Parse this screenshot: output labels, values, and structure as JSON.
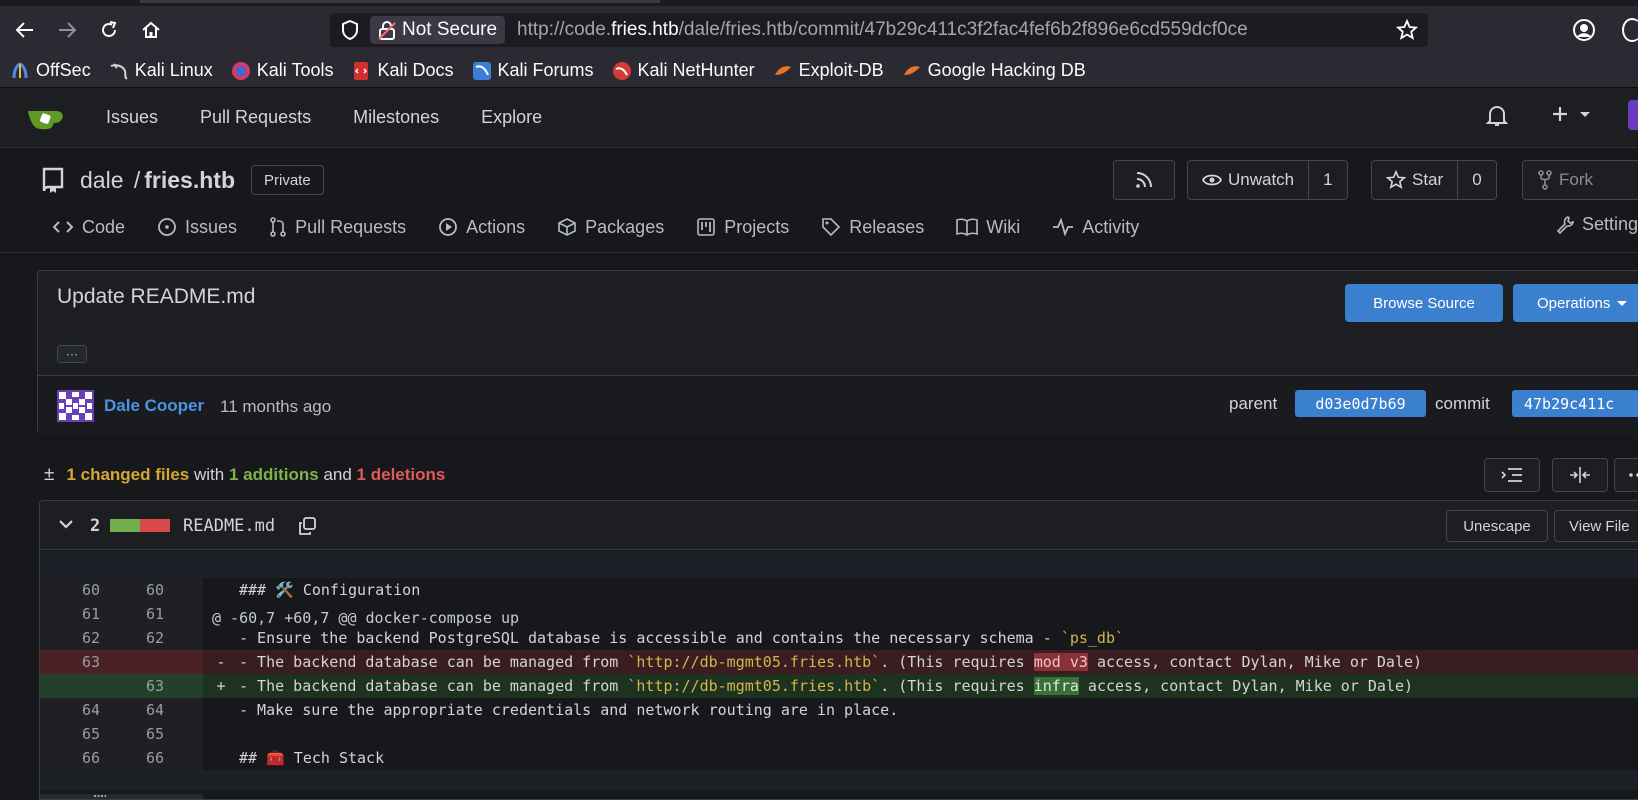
{
  "browser": {
    "url_prefix": "http://code.",
    "url_host": "fries.htb",
    "url_path": "/dale/fries.htb/commit/47b29c411c3f2fac4fef6b2f896e6cd559dcf0ce",
    "not_secure_label": "Not Secure",
    "bookmarks": [
      "OffSec",
      "Kali Linux",
      "Kali Tools",
      "Kali Docs",
      "Kali Forums",
      "Kali NetHunter",
      "Exploit-DB",
      "Google Hacking DB"
    ]
  },
  "gitea_nav": {
    "items": [
      "Issues",
      "Pull Requests",
      "Milestones",
      "Explore"
    ]
  },
  "repo": {
    "owner": "dale",
    "separator": "/",
    "name": "fries.htb",
    "visibility": "Private",
    "unwatch_label": "Unwatch",
    "watch_count": "1",
    "star_label": "Star",
    "star_count": "0",
    "fork_label": "Fork",
    "tabs": [
      "Code",
      "Issues",
      "Pull Requests",
      "Actions",
      "Packages",
      "Projects",
      "Releases",
      "Wiki",
      "Activity"
    ],
    "settings_label": "Settings"
  },
  "commit": {
    "title": "Update README.md",
    "ellipsis": "···",
    "browse_source": "Browse Source",
    "operations": "Operations",
    "author": "Dale Cooper",
    "time": "11 months ago",
    "parent_label": "parent",
    "parent_sha": "d03e0d7b69",
    "commit_label": "commit",
    "commit_sha": "47b29c411c"
  },
  "stats": {
    "pm": "±",
    "files": "1 changed files",
    "with": "with",
    "additions": "1 additions",
    "and": "and",
    "deletions": "1 deletions"
  },
  "diff_file": {
    "changes": "2",
    "filename": "README.md",
    "unescape": "Unescape",
    "view_file": "View File",
    "hunk_header": "@ -60,7 +60,7 @@ docker-compose up",
    "lines": [
      {
        "type": "ctx",
        "old": "60",
        "new": "60",
        "text": "### 🛠️ Configuration"
      },
      {
        "type": "ctx",
        "old": "61",
        "new": "61",
        "text": ""
      },
      {
        "type": "ctx",
        "old": "62",
        "new": "62",
        "text": "- Ensure the backend PostgreSQL database is accessible and contains the necessary schema - ",
        "str": "`ps_db`"
      },
      {
        "type": "del",
        "old": "63",
        "new": "",
        "sign": "-",
        "pre": "- The backend database can be managed from ",
        "str": "`http://db-mgmt05.fries.htb`",
        "mid": ". (This requires ",
        "hl": "mod v3",
        "post": " access, contact Dylan, Mike or Dale)"
      },
      {
        "type": "add",
        "old": "",
        "new": "63",
        "sign": "+",
        "pre": "- The backend database can be managed from ",
        "str": "`http://db-mgmt05.fries.htb`",
        "mid": ". (This requires ",
        "hl": "infra",
        "post": " access, contact Dylan, Mike or Dale)"
      },
      {
        "type": "ctx",
        "old": "64",
        "new": "64",
        "text": "- Make sure the appropriate credentials and network routing are in place."
      },
      {
        "type": "ctx",
        "old": "65",
        "new": "65",
        "text": ""
      },
      {
        "type": "ctx",
        "old": "66",
        "new": "66",
        "text": "## 🧰 Tech Stack"
      }
    ]
  }
}
